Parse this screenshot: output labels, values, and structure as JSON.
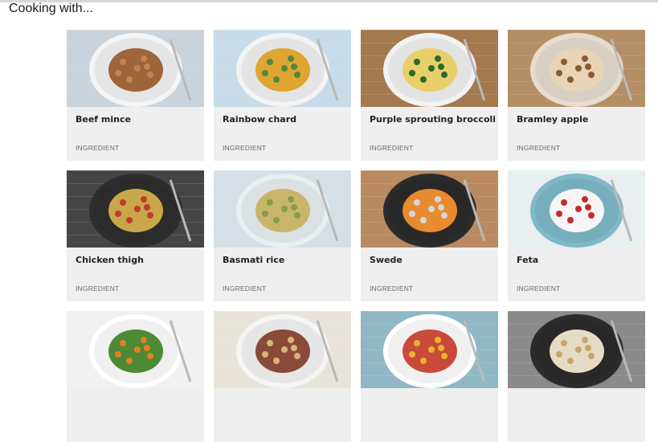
{
  "page": {
    "heading": "Cooking with..."
  },
  "cards": [
    {
      "title": "Beef mince",
      "type": "INGREDIENT",
      "image": "beef-mince-pasta-image",
      "bg": "#c9d3dc",
      "plate": "#f4f4f4",
      "food": "#a0643a",
      "accent": "#c48152"
    },
    {
      "title": "Rainbow chard",
      "type": "INGREDIENT",
      "image": "rainbow-chard-risotto-image",
      "bg": "#c7dce8",
      "plate": "#f3f3f3",
      "food": "#e0a431",
      "accent": "#4c8a3c"
    },
    {
      "title": "Purple sprouting broccoli",
      "type": "INGREDIENT",
      "image": "broccoli-pasta-image",
      "bg": "#a4794f",
      "plate": "#f2f2f2",
      "food": "#e8cf6a",
      "accent": "#2f6a2a"
    },
    {
      "title": "Bramley apple",
      "type": "INGREDIENT",
      "image": "apple-strudel-image",
      "bg": "#b58e66",
      "plate": "#e6dcd0",
      "food": "#e8d4b6",
      "accent": "#8b5a33"
    },
    {
      "title": "Chicken thigh",
      "type": "INGREDIENT",
      "image": "chicken-traybake-image",
      "bg": "#454545",
      "plate": "#2e2e2e",
      "food": "#c9a64a",
      "accent": "#c03a2b"
    },
    {
      "title": "Basmati rice",
      "type": "INGREDIENT",
      "image": "basmati-rice-image",
      "bg": "#d6dfe6",
      "plate": "#e9eef1",
      "food": "#c9b56a",
      "accent": "#8a9b4a"
    },
    {
      "title": "Swede",
      "type": "INGREDIENT",
      "image": "swede-mash-image",
      "bg": "#b98a61",
      "plate": "#2b2b2b",
      "food": "#e88a2f",
      "accent": "#d6d6d6"
    },
    {
      "title": "Feta",
      "type": "INGREDIENT",
      "image": "feta-salad-image",
      "bg": "#e9eef0",
      "plate": "#7fb9c8",
      "food": "#f6f6f6",
      "accent": "#c62b2b"
    },
    {
      "title": "",
      "type": "",
      "image": "grain-salad-image",
      "bg": "#f1f1f1",
      "plate": "#ffffff",
      "food": "#4d8a35",
      "accent": "#e67e22"
    },
    {
      "title": "",
      "type": "",
      "image": "roast-lamb-image",
      "bg": "#e8e4da",
      "plate": "#f5f5f5",
      "food": "#8a4a3a",
      "accent": "#d7b67a"
    },
    {
      "title": "",
      "type": "",
      "image": "pasta-salad-image",
      "bg": "#8fb8c4",
      "plate": "#ffffff",
      "food": "#c94a3a",
      "accent": "#e6b52e"
    },
    {
      "title": "",
      "type": "",
      "image": "creamy-pan-image",
      "bg": "#8a8a8a",
      "plate": "#2b2b2b",
      "food": "#e6dcc6",
      "accent": "#c8a46e"
    }
  ]
}
